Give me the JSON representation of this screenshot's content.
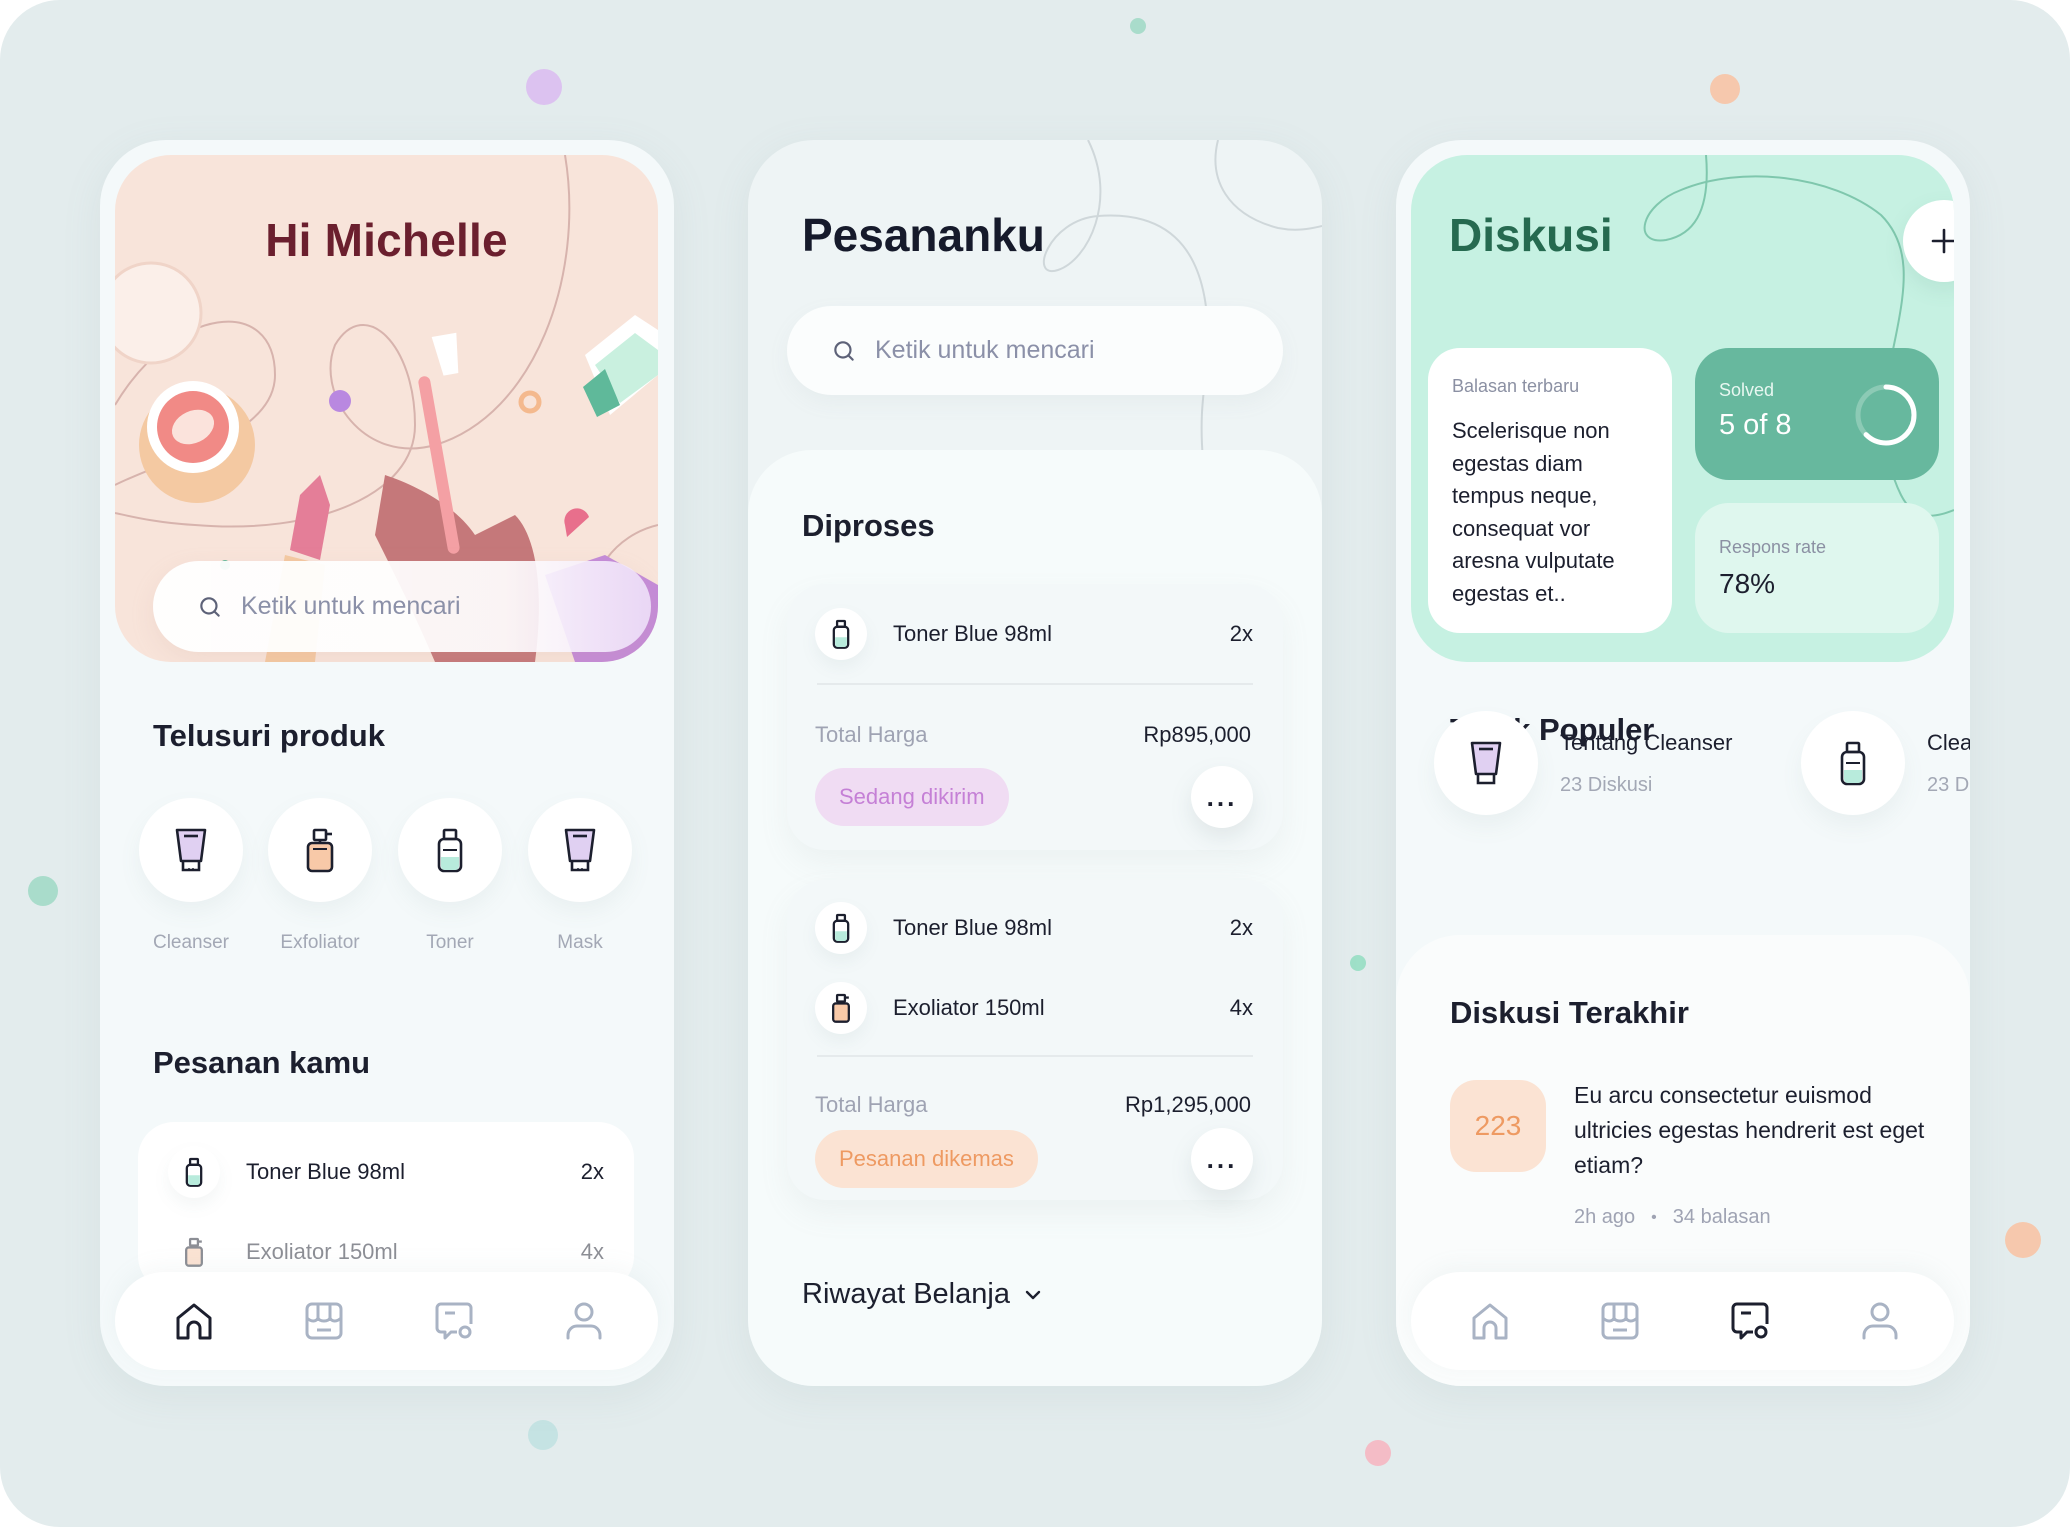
{
  "colors": {
    "background": "#e3eced",
    "hero_peach": "#f8e4da",
    "hero_title": "#6b1f2e",
    "mint_header": "#c6f1e2",
    "mint_title": "#266a50",
    "solved_card": "#67b89e",
    "status_shipping_bg": "#f0dcf3",
    "status_shipping_fg": "#c580d6",
    "status_packing_bg": "#fbe3d3",
    "status_packing_fg": "#ee9a62",
    "nav_active": "#1c1f2e",
    "nav_inactive": "#a9b3c4"
  },
  "home": {
    "greeting": "Hi Michelle",
    "search_placeholder": "Ketik untuk mencari",
    "browse_title": "Telusuri produk",
    "categories": [
      {
        "label": "Cleanser",
        "icon": "cleanser-tube-icon"
      },
      {
        "label": "Exfoliator",
        "icon": "exfoliator-pump-bottle-icon"
      },
      {
        "label": "Toner",
        "icon": "toner-bottle-icon"
      },
      {
        "label": "Mask",
        "icon": "mask-tube-icon"
      }
    ],
    "orders_title": "Pesanan kamu",
    "orders": [
      {
        "name": "Toner Blue 98ml",
        "qty": "2x",
        "icon": "toner-bottle-icon"
      },
      {
        "name": "Exoliator 150ml",
        "qty": "4x",
        "icon": "exfoliator-pump-bottle-icon"
      }
    ],
    "nav": [
      {
        "name": "home",
        "icon": "home-icon",
        "active": true
      },
      {
        "name": "store",
        "icon": "store-icon",
        "active": false
      },
      {
        "name": "discussion",
        "icon": "chat-icon",
        "active": false
      },
      {
        "name": "profile",
        "icon": "user-icon",
        "active": false
      }
    ]
  },
  "orders_screen": {
    "title": "Pesananku",
    "search_placeholder": "Ketik untuk mencari",
    "processing_title": "Diproses",
    "orders": [
      {
        "items": [
          {
            "name": "Toner Blue 98ml",
            "qty": "2x",
            "icon": "toner-bottle-icon"
          }
        ],
        "total_label": "Total Harga",
        "total_value": "Rp895,000",
        "status": "Sedang dikirim"
      },
      {
        "items": [
          {
            "name": "Toner Blue 98ml",
            "qty": "2x",
            "icon": "toner-bottle-icon"
          },
          {
            "name": "Exoliator 150ml",
            "qty": "4x",
            "icon": "exfoliator-pump-bottle-icon"
          }
        ],
        "total_label": "Total Harga",
        "total_value": "Rp1,295,000",
        "status": "Pesanan dikemas"
      }
    ],
    "more_label": "...",
    "history_label": "Riwayat Belanja"
  },
  "discussion": {
    "title": "Diskusi",
    "add_label": "+",
    "latest_reply_label": "Balasan terbaru",
    "latest_reply_text": "Scelerisque non egestas diam tempus neque, consequat vor aresna vulputate egestas et..",
    "solved_label": "Solved",
    "solved_value": "5 of 8",
    "solved_done": 5,
    "solved_total": 8,
    "response_label": "Respons rate",
    "response_value": "78%",
    "popular_title": "Topik Populer",
    "topics": [
      {
        "title": "Tentang Cleanser",
        "count": "23 Diskusi",
        "icon": "cleanser-tube-icon"
      },
      {
        "title": "Clea",
        "count": "23 D",
        "icon": "toner-bottle-icon"
      }
    ],
    "recent_title": "Diskusi Terakhir",
    "recent": {
      "count": "223",
      "text": "Eu arcu consectetur euismod ultricies egestas hendrerit est eget etiam?",
      "time": "2h ago",
      "separator": "•",
      "replies": "34 balasan"
    },
    "nav": [
      {
        "name": "home",
        "icon": "home-icon",
        "active": false
      },
      {
        "name": "store",
        "icon": "store-icon",
        "active": false
      },
      {
        "name": "discussion",
        "icon": "chat-icon",
        "active": true
      },
      {
        "name": "profile",
        "icon": "user-icon",
        "active": false
      }
    ]
  }
}
